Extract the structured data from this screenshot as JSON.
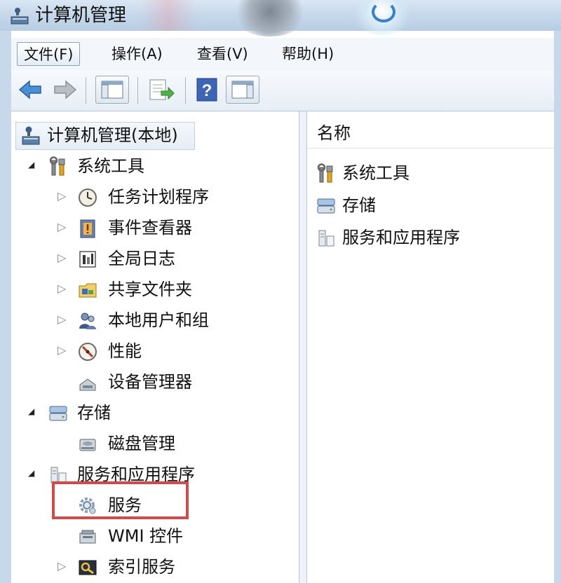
{
  "window": {
    "title": "计算机管理"
  },
  "menu": {
    "file": "文件(F)",
    "action": "操作(A)",
    "view": "查看(V)",
    "help": "帮助(H)"
  },
  "tree": {
    "root": "计算机管理(本地)",
    "system_tools": "系统工具",
    "task_scheduler": "任务计划程序",
    "event_viewer": "事件查看器",
    "global_log": "全局日志",
    "shared_folders": "共享文件夹",
    "local_users": "本地用户和组",
    "performance": "性能",
    "device_manager": "设备管理器",
    "storage": "存储",
    "disk_management": "磁盘管理",
    "services_apps": "服务和应用程序",
    "services": "服务",
    "wmi": "WMI 控件",
    "indexing": "索引服务"
  },
  "list": {
    "header_name": "名称",
    "items": [
      "系统工具",
      "存储",
      "服务和应用程序"
    ]
  },
  "colors": {
    "highlight": "#d04a4a",
    "title_bar": "#c4d6ea"
  }
}
